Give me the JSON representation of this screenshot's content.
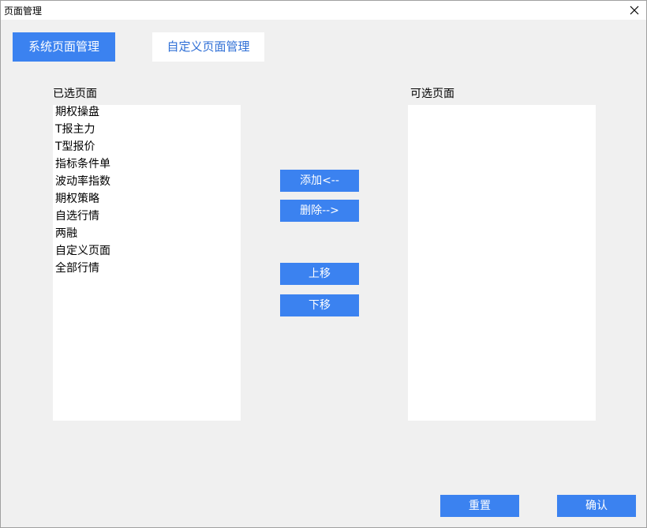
{
  "window": {
    "title": "页面管理"
  },
  "tabs": [
    {
      "label": "系统页面管理",
      "active": true
    },
    {
      "label": "自定义页面管理",
      "active": false
    }
  ],
  "selected": {
    "label": "已选页面",
    "items": [
      "期权操盘",
      "T报主力",
      "T型报价",
      "指标条件单",
      "波动率指数",
      "期权策略",
      "自选行情",
      "两融",
      "自定义页面",
      "全部行情"
    ]
  },
  "available": {
    "label": "可选页面",
    "items": []
  },
  "actions": {
    "add": "添加<--",
    "remove": "删除-->",
    "move_up": "上移",
    "move_down": "下移"
  },
  "footer": {
    "reset": "重置",
    "confirm": "确认"
  },
  "colors": {
    "accent": "#3b82f0",
    "tab_inactive_text": "#2f6fd6",
    "background": "#f0f0f0"
  }
}
